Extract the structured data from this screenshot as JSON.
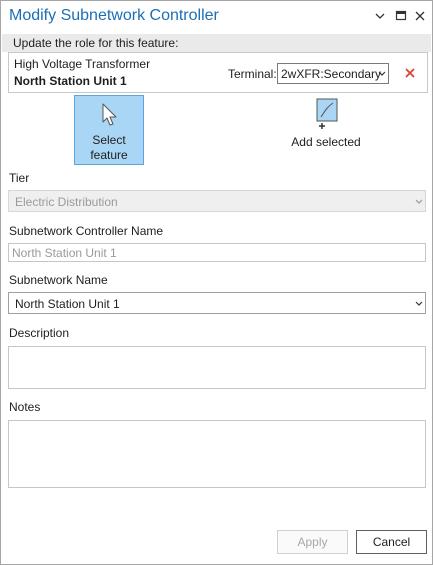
{
  "pane": {
    "title": "Modify Subnetwork Controller",
    "title_buttons": [
      "chevron-down-icon",
      "maximize-icon",
      "close-icon"
    ]
  },
  "role_section": {
    "header": "Update the role for this feature:",
    "feature_type": "High Voltage Transformer",
    "feature_name": "North Station Unit 1",
    "terminal_label": "Terminal:",
    "terminal_value": "2wXFR:Secondary"
  },
  "tools": {
    "select_feature_line1": "Select",
    "select_feature_line2": "feature",
    "add_selected": "Add selected"
  },
  "form": {
    "tier_label": "Tier",
    "tier_value": "Electric Distribution",
    "controller_name_label": "Subnetwork Controller Name",
    "controller_name_placeholder": "North Station Unit 1",
    "subnetwork_name_label": "Subnetwork Name",
    "subnetwork_name_value": "North Station Unit 1",
    "description_label": "Description",
    "description_value": "",
    "notes_label": "Notes",
    "notes_value": ""
  },
  "buttons": {
    "apply": "Apply",
    "cancel": "Cancel"
  },
  "colors": {
    "title": "#1b6fb5",
    "selected_tool_bg": "#a9d6f5",
    "remove_x": "#d9432f"
  }
}
